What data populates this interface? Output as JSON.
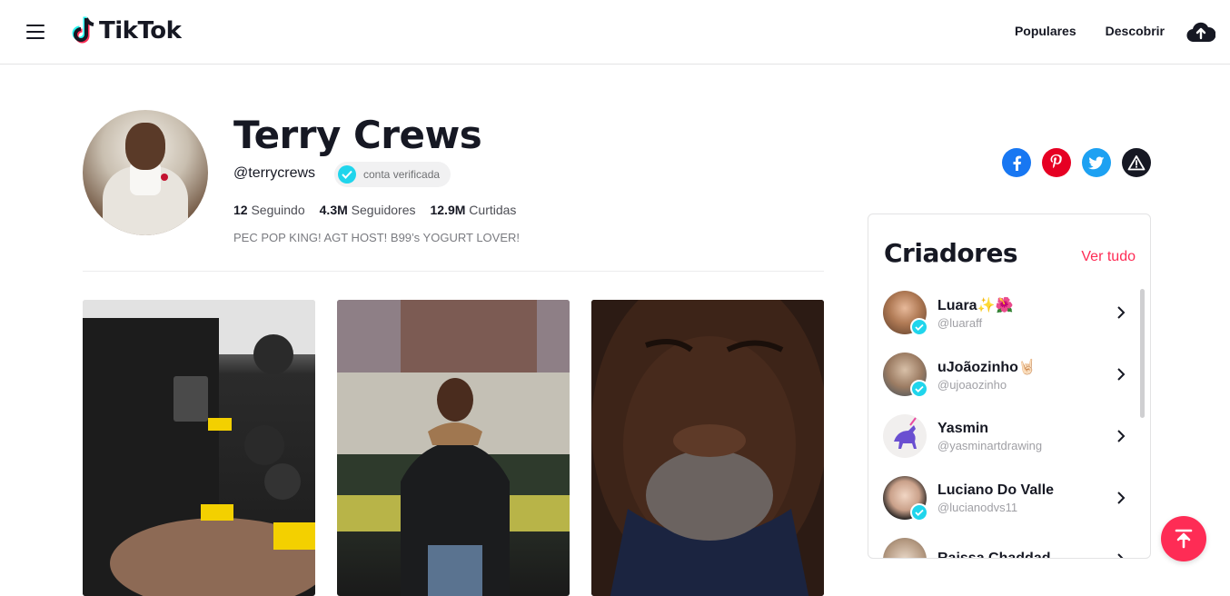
{
  "header": {
    "logo_text": "TikTok",
    "nav": {
      "popular": "Populares",
      "discover": "Descobrir"
    }
  },
  "profile": {
    "name": "Terry Crews",
    "handle": "@terrycrews",
    "verified_label": "conta verificada",
    "stats": {
      "following_count": "12",
      "following_label": "Seguindo",
      "followers_count": "4.3M",
      "followers_label": "Seguidores",
      "likes_count": "12.9M",
      "likes_label": "Curtidas"
    },
    "bio": "PEC POP KING! AGT HOST! B99’s YOGURT LOVER!"
  },
  "share_icons": [
    "facebook-icon",
    "pinterest-icon",
    "twitter-icon",
    "report-icon"
  ],
  "creators": {
    "title": "Criadores",
    "see_all": "Ver tudo",
    "items": [
      {
        "name": "Luara✨🌺",
        "handle": "@luaraff",
        "verified": true
      },
      {
        "name": "uJoãozinho🤘🏻",
        "handle": "@ujoaozinho",
        "verified": true
      },
      {
        "name": "Yasmin",
        "handle": "@yasminartdrawing",
        "verified": false
      },
      {
        "name": "Luciano Do Valle",
        "handle": "@lucianodvs11",
        "verified": true
      },
      {
        "name": "Raissa Chaddad",
        "handle": "",
        "verified": false
      }
    ]
  },
  "colors": {
    "brand": "#fe2c55",
    "verified": "#20d5ec",
    "facebook": "#1877f2",
    "pinterest": "#e60023",
    "twitter": "#1da1f2"
  }
}
